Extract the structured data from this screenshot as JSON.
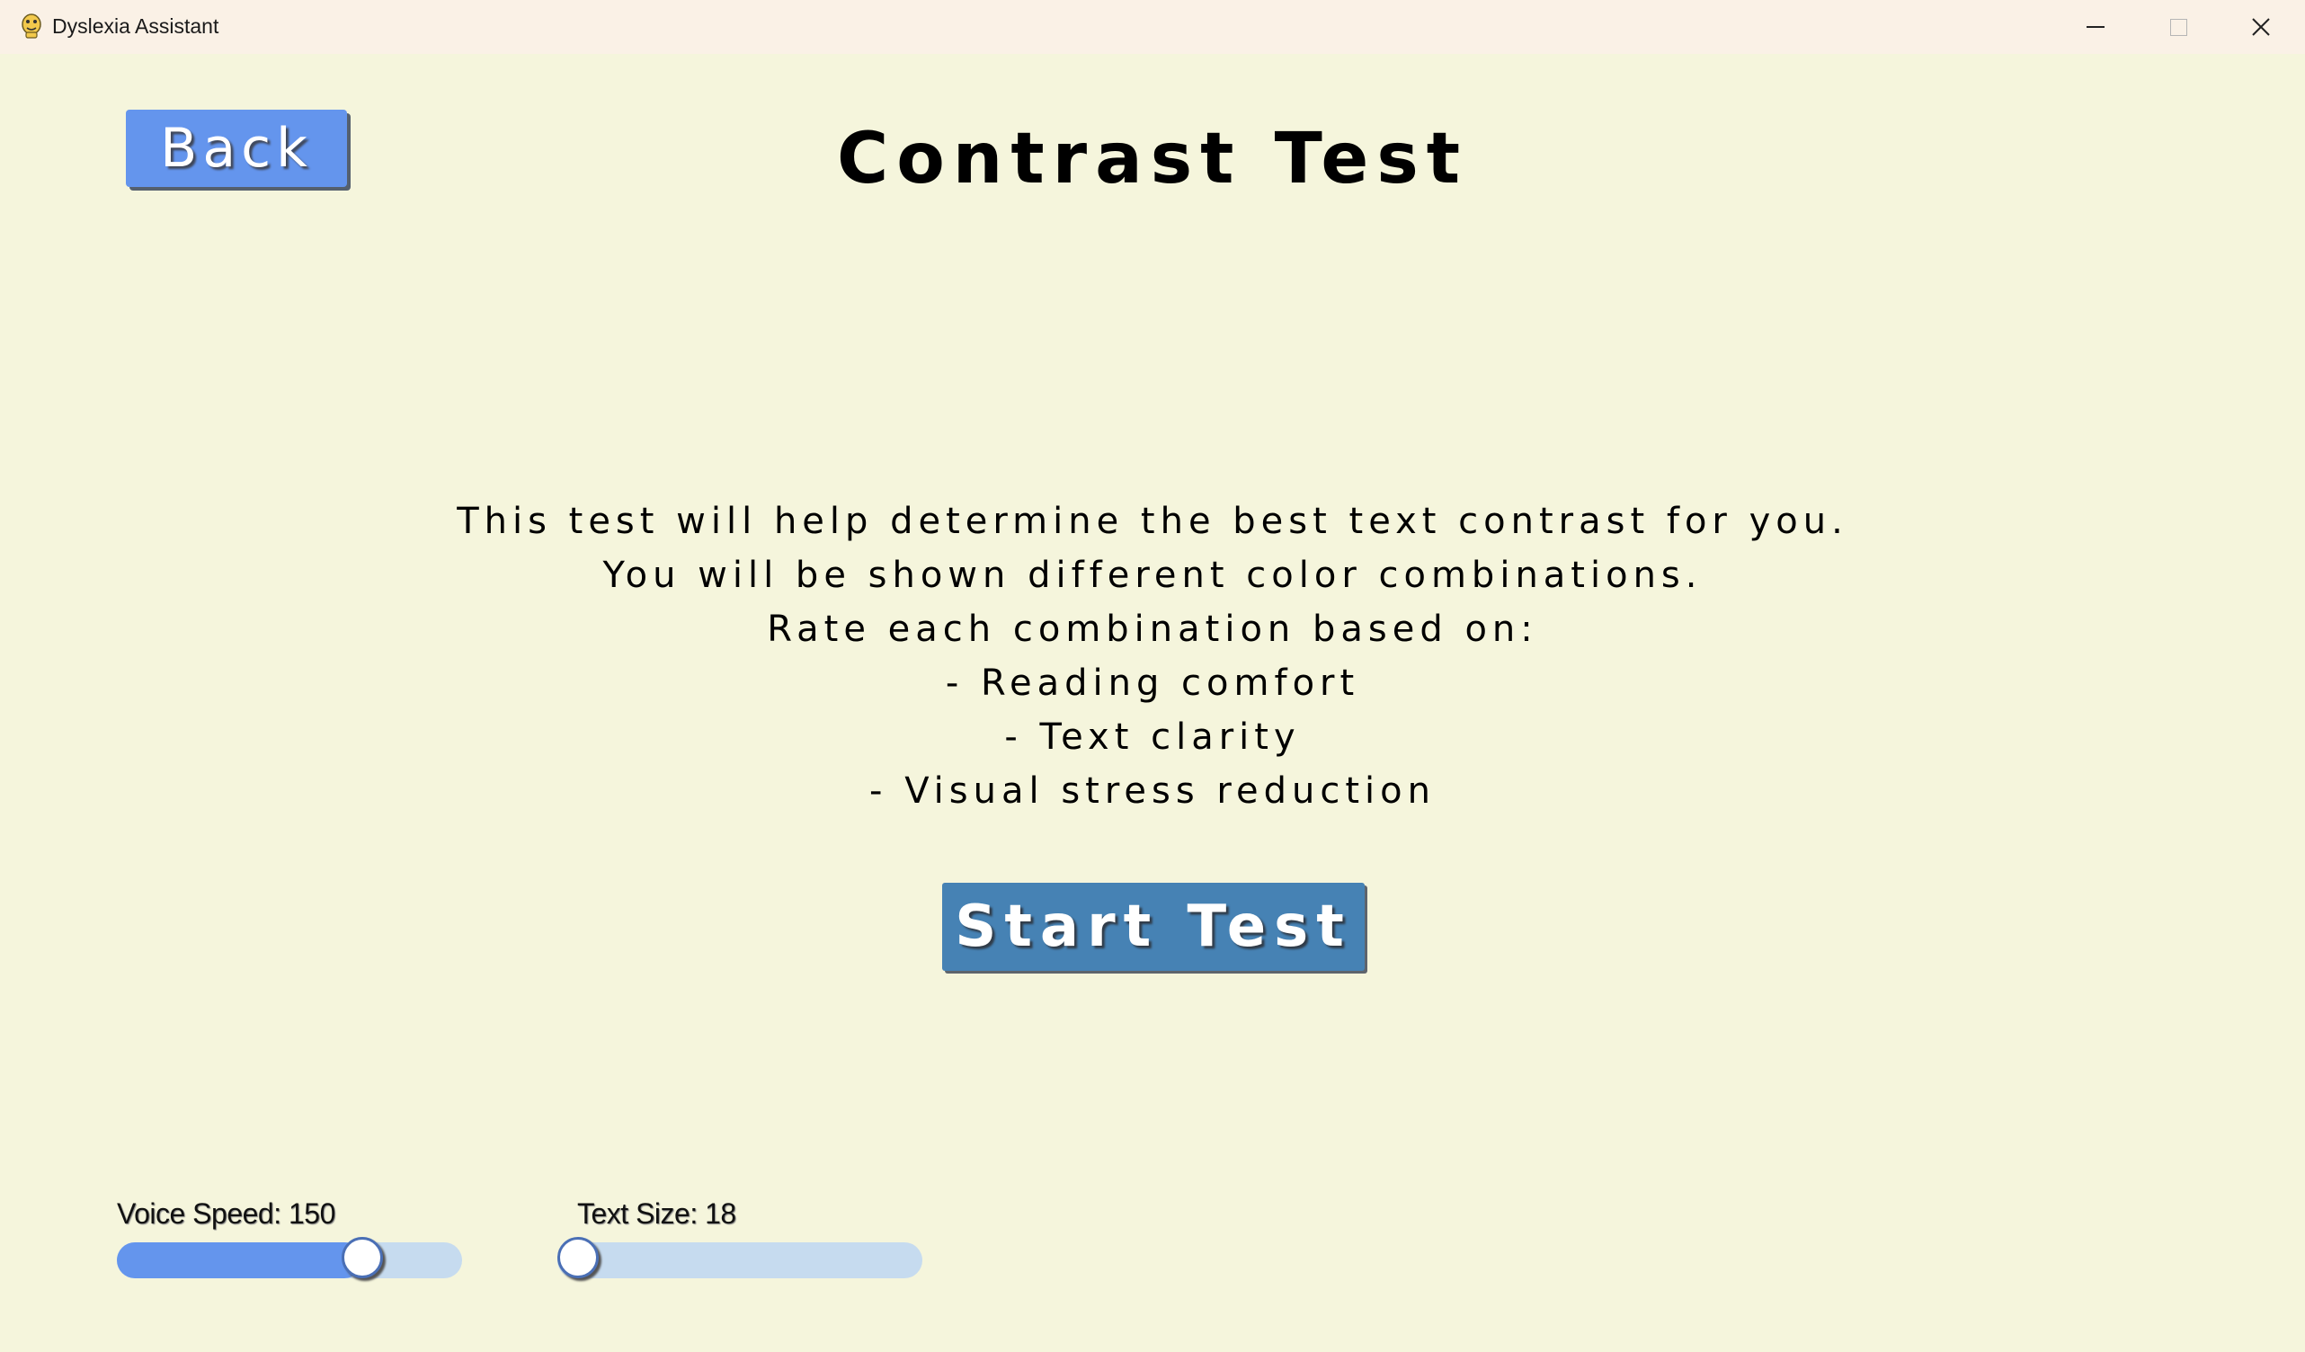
{
  "window": {
    "title": "Dyslexia Assistant",
    "icon": "python-snake-icon"
  },
  "header": {
    "back_label": "Back",
    "title": "Contrast Test"
  },
  "instructions": [
    "This test will help determine the best text contrast for you.",
    "You will be shown different color combinations.",
    "Rate each combination based on:",
    "- Reading comfort",
    "- Text clarity",
    "- Visual stress reduction"
  ],
  "start_button_label": "Start Test",
  "sliders": {
    "voice_speed": {
      "label": "Voice Speed: 150",
      "value": 150,
      "fraction": 0.74
    },
    "text_size": {
      "label": "Text Size: 18",
      "value": 18,
      "fraction": 0.0
    }
  },
  "colors": {
    "background": "#f5f5dc",
    "back_button": "#6495ed",
    "start_button": "#4682b4",
    "slider_fill": "#6495ed",
    "slider_track": "#c6dbef"
  }
}
